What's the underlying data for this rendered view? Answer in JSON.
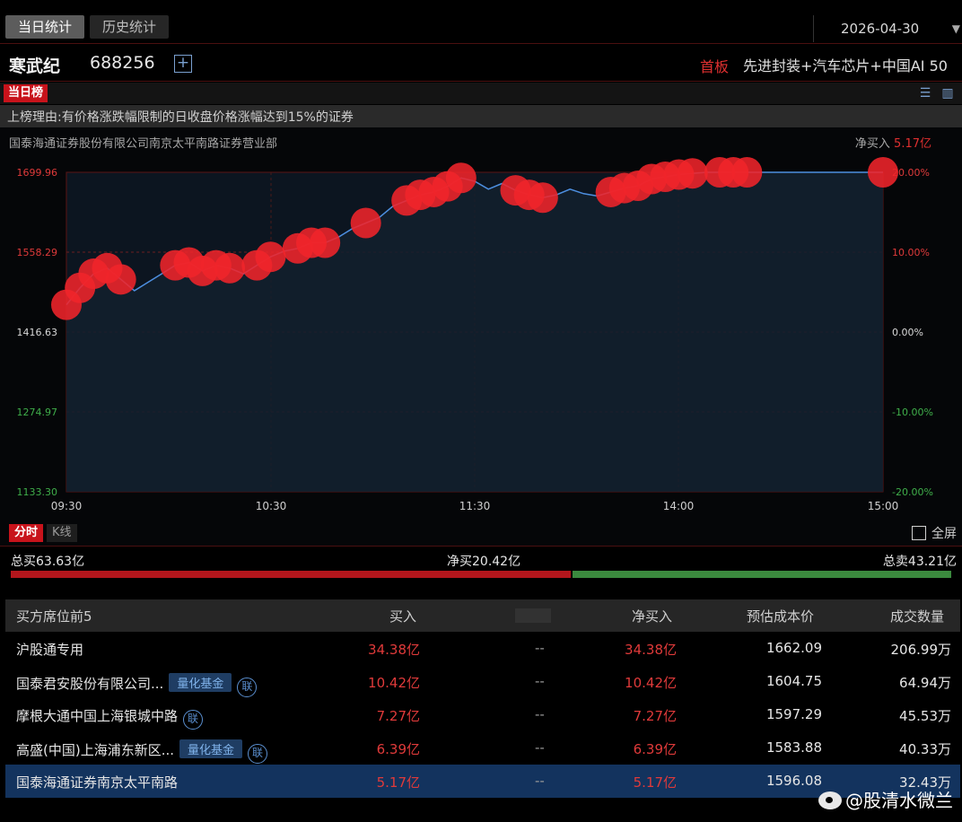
{
  "tabs": [
    {
      "label": "当日统计",
      "active": true
    },
    {
      "label": "历史统计",
      "active": false
    }
  ],
  "date_selector": {
    "value": "2026-04-30"
  },
  "stock": {
    "name": "寒武纪",
    "code": "688256",
    "board": "首板",
    "concepts": "先进封装+汽车芯片+中国AI 50"
  },
  "rank": {
    "label": "当日榜"
  },
  "reason": {
    "text": "上榜理由:有价格涨跌幅限制的日收盘价格涨幅达到15%的证券"
  },
  "chart_header": {
    "broker": "国泰海通证券股份有限公司南京太平南路证券营业部",
    "net_buy_label": "净买入",
    "net_buy_value": "5.17亿"
  },
  "chart_data": {
    "type": "line",
    "x_labels": [
      "09:30",
      "10:30",
      "11:30",
      "14:00",
      "15:00"
    ],
    "y_ticks": [
      "1699.96",
      "1558.29",
      "1416.63",
      "1274.97",
      "1133.30"
    ],
    "y_right_ticks": [
      "20.00%",
      "10.00%",
      "0.00%",
      "-10.00%",
      "-20.00%"
    ],
    "ylim": [
      1133.3,
      1699.96
    ],
    "series": [
      {
        "values": [
          1465,
          1495,
          1520,
          1530,
          1510,
          1490,
          1505,
          1520,
          1535,
          1540,
          1525,
          1535,
          1530,
          1520,
          1535,
          1550,
          1560,
          1565,
          1575,
          1575,
          1585,
          1600,
          1610,
          1620,
          1640,
          1650,
          1660,
          1665,
          1675,
          1690,
          1684,
          1670,
          1680,
          1668,
          1660,
          1655,
          1660,
          1670,
          1662,
          1658,
          1665,
          1672,
          1676,
          1688,
          1692,
          1696,
          1698,
          1699.96,
          1699.96,
          1699.96,
          1699.96,
          1699.96,
          1699.96,
          1699.96,
          1699.96,
          1699.96,
          1699.96,
          1699.96,
          1699.96,
          1699.96,
          1699.96
        ]
      }
    ]
  },
  "chart_footer": {
    "tab_timeshare": "分时",
    "tab_kline": "K线",
    "fullscreen": "全屏"
  },
  "flow": {
    "total_buy": "总买63.63亿",
    "net_buy": "净买20.42亿",
    "total_sell": "总卖43.21亿",
    "buy_fraction": 0.5956
  },
  "table": {
    "headers": {
      "name": "买方席位前5",
      "buy": "买入",
      "net_buy": "净买入",
      "cost": "预估成本价",
      "volume": "成交数量"
    },
    "rows": [
      {
        "name": "沪股通专用",
        "buy": "34.38亿",
        "sell": "--",
        "net": "34.38亿",
        "cost": "1662.09",
        "volume": "206.99万"
      },
      {
        "name": "国泰君安股份有限公司...",
        "badge": "量化基金",
        "lian": "联",
        "buy": "10.42亿",
        "sell": "--",
        "net": "10.42亿",
        "cost": "1604.75",
        "volume": "64.94万"
      },
      {
        "name": "摩根大通中国上海银城中路",
        "lian": "联",
        "buy": "7.27亿",
        "sell": "--",
        "net": "7.27亿",
        "cost": "1597.29",
        "volume": "45.53万"
      },
      {
        "name": "高盛(中国)上海浦东新区...",
        "badge": "量化基金",
        "lian": "联",
        "buy": "6.39亿",
        "sell": "--",
        "net": "6.39亿",
        "cost": "1583.88",
        "volume": "40.33万"
      },
      {
        "name": "国泰海通证券南京太平南路",
        "buy": "5.17亿",
        "sell": "--",
        "net": "5.17亿",
        "cost": "1596.08",
        "volume": "32.43万"
      }
    ]
  },
  "watermark": {
    "text": "@股清水微兰"
  },
  "colors": {
    "up": "#e03a3a",
    "down": "#3b8a3e",
    "accent": "#c8131b",
    "line": "#4d8fe0"
  }
}
